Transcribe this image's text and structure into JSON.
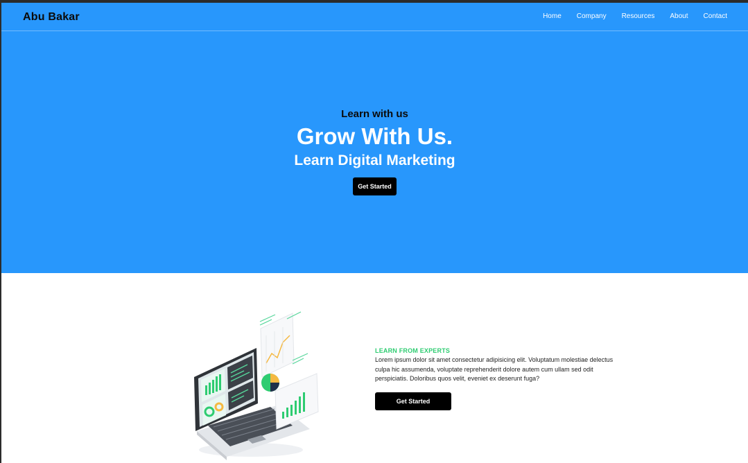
{
  "header": {
    "logo": "Abu Bakar",
    "nav": [
      "Home",
      "Company",
      "Resources",
      "About",
      "Contact"
    ]
  },
  "hero": {
    "kicker": "Learn with us",
    "title": "Grow With Us.",
    "subtitle": "Learn Digital Marketing",
    "cta": "Get Started",
    "bg_color": "#2897fc"
  },
  "feature": {
    "tag": "LEARN FROM EXPERTS",
    "text": "Lorem ipsum dolor sit amet consectetur adipisicing elit. Voluptatum molestiae delectus culpa hic assumenda, voluptate reprehenderit dolore autem cum ullam sed odit perspiciatis. Doloribus quos velit, eveniet ex deserunt fuga?",
    "cta": "Get Started",
    "tag_color": "#2ecc71",
    "illustration_icon": "laptop-analytics-illustration"
  }
}
